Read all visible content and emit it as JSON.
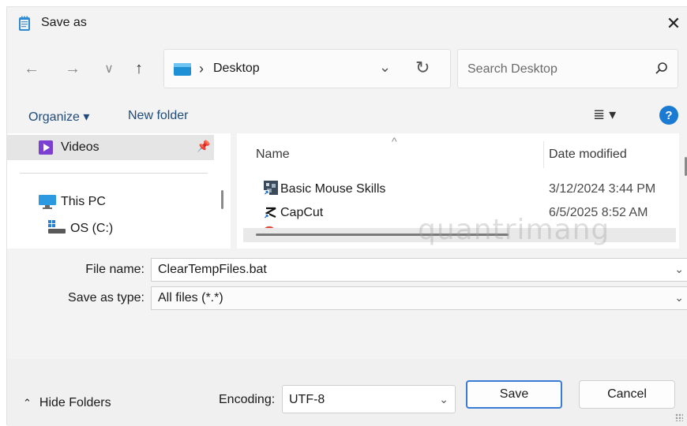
{
  "window": {
    "title": "Save as"
  },
  "nav": {
    "back": "←",
    "forward": "→",
    "recent": "∨",
    "up": "↑"
  },
  "address": {
    "separator": "›",
    "path": "Desktop"
  },
  "search": {
    "placeholder": "Search Desktop"
  },
  "commandbar": {
    "organize": "Organize ▾",
    "new_folder": "New folder",
    "view": "≣  ▾",
    "help": "?"
  },
  "navigation_pane": {
    "items": [
      {
        "label": "Videos",
        "icon": "videos-folder-icon",
        "selected": true,
        "pinned": true
      },
      {
        "label": "This PC",
        "icon": "monitor-icon"
      },
      {
        "label": "OS (C:)",
        "icon": "drive-icon"
      }
    ]
  },
  "file_list": {
    "columns": {
      "name": "Name",
      "date_modified": "Date modified"
    },
    "rows": [
      {
        "name": "Basic Mouse Skills",
        "date": "3/12/2024 3:44 PM",
        "icon": "shortcut-icon"
      },
      {
        "name": "CapCut",
        "date": "6/5/2025 8:52 AM",
        "icon": "capcut-shortcut-icon"
      }
    ]
  },
  "fields": {
    "file_name_label": "File name:",
    "file_name_value": "ClearTempFiles.bat",
    "save_as_type_label": "Save as type:",
    "save_as_type_value": "All files  (*.*)"
  },
  "footer": {
    "hide_folders": "Hide Folders",
    "encoding_label": "Encoding:",
    "encoding_value": "UTF-8",
    "save": "Save",
    "cancel": "Cancel"
  },
  "watermark": "quantrimang",
  "colors": {
    "accent": "#1b7ad2",
    "link": "#1f4b7a",
    "primary_border": "#3a7bd5"
  }
}
